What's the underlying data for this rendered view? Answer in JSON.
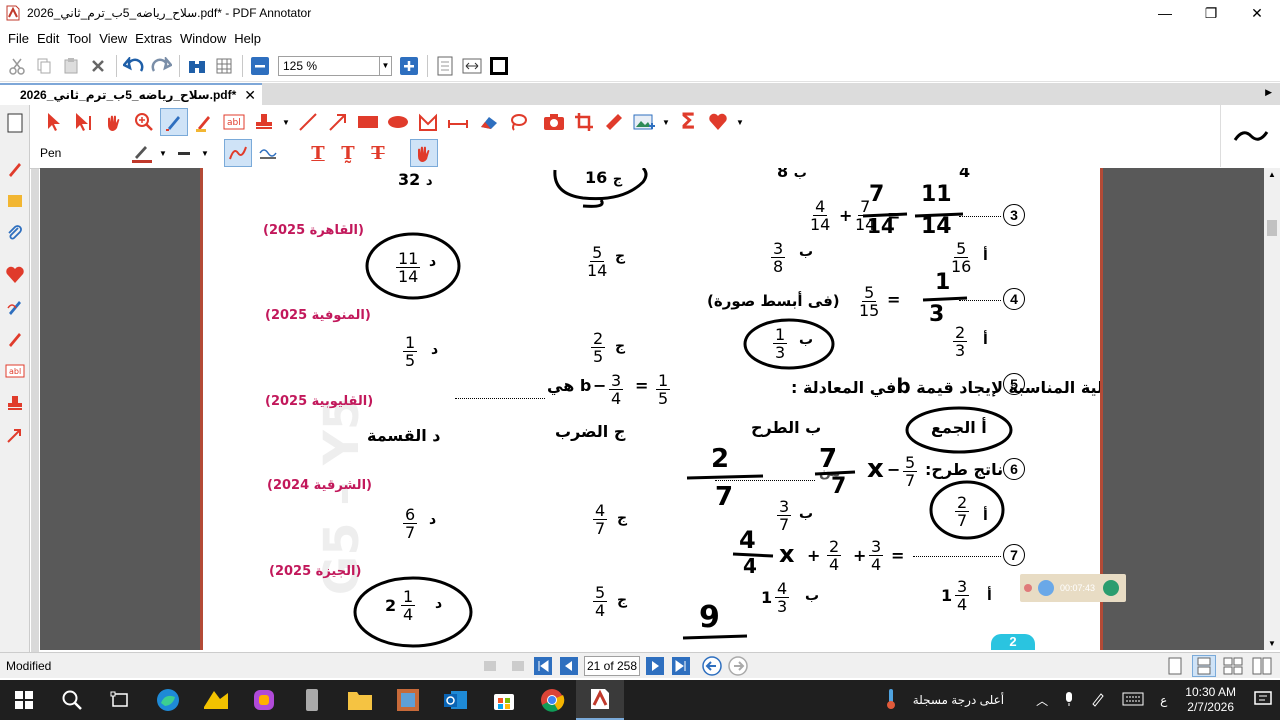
{
  "window": {
    "title": "سلاح_رياضه_5ب_ترم_ثاني_2026.pdf* - PDF Annotator",
    "minimize": "—",
    "restore": "❐",
    "close": "✕"
  },
  "menu": [
    "File",
    "Edit",
    "Tool",
    "View",
    "Extras",
    "Window",
    "Help"
  ],
  "zoom": {
    "value": "125 %"
  },
  "tab": {
    "label": "سلاح_رياضه_5ب_ترم_ثاني_2026.pdf*",
    "close": "✕"
  },
  "tools": {
    "pen_label": "Pen"
  },
  "page": {
    "partial_top": {
      "d": "32",
      "d_letter": "د",
      "j": "16",
      "j_letter": "ج",
      "b": "8",
      "b_letter": "ب",
      "a": "4"
    },
    "q3": {
      "num": "3",
      "a_num": "4",
      "a_den": "14",
      "b_num": "7",
      "b_den": "14",
      "source": "(القاهرة 2025)",
      "opts": {
        "a": {
          "letter": "أ",
          "num": "5",
          "den": "16"
        },
        "b": {
          "letter": "ب",
          "num": "3",
          "den": "8"
        },
        "j": {
          "letter": "ج",
          "num": "5",
          "den": "14"
        },
        "d": {
          "letter": "د",
          "num": "11",
          "den": "14"
        }
      },
      "ink_num": "11",
      "ink_den": "14"
    },
    "q4": {
      "num": "4",
      "f_num": "5",
      "f_den": "15",
      "text": "(فى أبسط صورة)",
      "source": "(المنوفية 2025)",
      "opts": {
        "a": {
          "letter": "أ",
          "num": "2",
          "den": "3"
        },
        "b": {
          "letter": "ب",
          "num": "1",
          "den": "3"
        },
        "j": {
          "letter": "ج",
          "num": "2",
          "den": "5"
        },
        "d": {
          "letter": "د",
          "num": "1",
          "den": "5"
        }
      },
      "ink_num": "1",
      "ink_den": "3"
    },
    "q5": {
      "num": "5",
      "text_start": "العملية المناسبة لإيجاد قيمة",
      "text_b": "b",
      "text_mid": "في المعادلة :",
      "eq_num1": "1",
      "eq_den1": "5",
      "eq_num2": "3",
      "eq_den2": "4",
      "text_end": "b هي",
      "source": "(القليوبية 2025)",
      "opts": {
        "a": "أ الجمع",
        "b": "ب الطرح",
        "j": "ج الضرب",
        "d": "د القسمة"
      }
    },
    "q6": {
      "num": "6",
      "text": "ناتج طرح:",
      "f_num": "5",
      "f_den": "7",
      "text2": "من",
      "source": "(الشرقية 2024)",
      "opts": {
        "a": {
          "letter": "أ",
          "num": "2",
          "den": "7"
        },
        "b": {
          "letter": "ب",
          "num": "3",
          "den": "7"
        },
        "j": {
          "letter": "ج",
          "num": "4",
          "den": "7"
        },
        "d": {
          "letter": "د",
          "num": "6",
          "den": "7"
        }
      },
      "ink_left_num": "2",
      "ink_left_den": "7",
      "ink_mid_num": "7",
      "ink_mid_den": "7",
      "ink_x": "x"
    },
    "q7": {
      "num": "7",
      "f1_num": "3",
      "f1_den": "4",
      "f2_num": "2",
      "f2_den": "4",
      "source": "(الجيزة 2025)",
      "opts": {
        "a": {
          "letter": "أ",
          "whole": "1",
          "num": "3",
          "den": "4"
        },
        "b": {
          "letter": "ب",
          "whole": "1",
          "num": "4",
          "den": "3"
        },
        "j": {
          "letter": "ج",
          "num": "5",
          "den": "4"
        },
        "d": {
          "letter": "د",
          "whole": "2",
          "num": "1",
          "den": "4"
        }
      },
      "ink_num": "4",
      "ink_den": "4",
      "ink_x": "x",
      "ink_bottom": "9"
    },
    "bottom_badge": "2"
  },
  "recorder": {
    "time": "00:07:43"
  },
  "status": {
    "text": "Modified",
    "page_indicator": "21 of 258"
  },
  "taskbar": {
    "weather": "أعلى درجة مسجلة",
    "lang": "ع",
    "time": "10:30 AM",
    "date": "2/7/2026"
  },
  "colors": {
    "accent_red": "#e03b2b",
    "source_pink": "#c2185b",
    "page_border": "#b34a36",
    "viewer_bg": "#595959"
  }
}
